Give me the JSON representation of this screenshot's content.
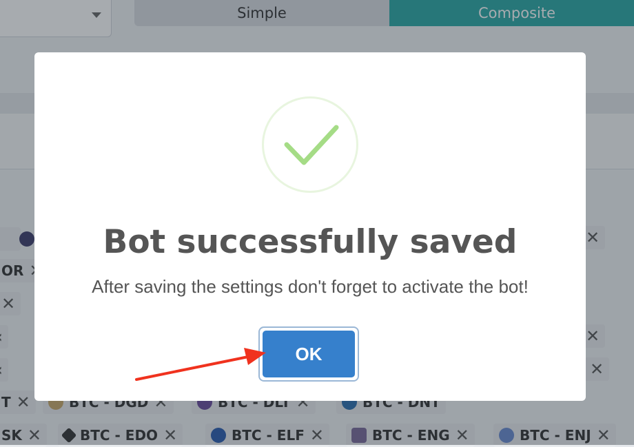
{
  "background": {
    "mode_tabs": [
      {
        "label": "Simple",
        "active": false
      },
      {
        "label": "Composite",
        "active": true
      }
    ],
    "chips_row1": [
      {
        "label": "BTC - DGD",
        "coin_color": "#c8a86a"
      },
      {
        "label": "BTC - DLT",
        "coin_color": "#6a4a9c"
      },
      {
        "label": "BTC - DNT",
        "coin_color": "#2c6fb0"
      }
    ],
    "chips_row2": [
      {
        "label": "BTC - EDO",
        "coin_color": "#333333"
      },
      {
        "label": "BTC - ELF",
        "coin_color": "#2a5cb0"
      },
      {
        "label": "BTC - ENG",
        "coin_color": "#7a6a9a"
      },
      {
        "label": "BTC - ENJ",
        "coin_color": "#6a8ad0"
      }
    ],
    "partial_labels": {
      "row_a": "OR",
      "row_b": "T",
      "row_c": "SK"
    }
  },
  "modal": {
    "title": "Bot successfully saved",
    "message": "After saving the settings don't forget to activate the bot!",
    "ok_label": "OK",
    "success_color": "#a5dc86",
    "button_color": "#3680cc"
  },
  "annotation": {
    "arrow_color": "#f0321e"
  }
}
